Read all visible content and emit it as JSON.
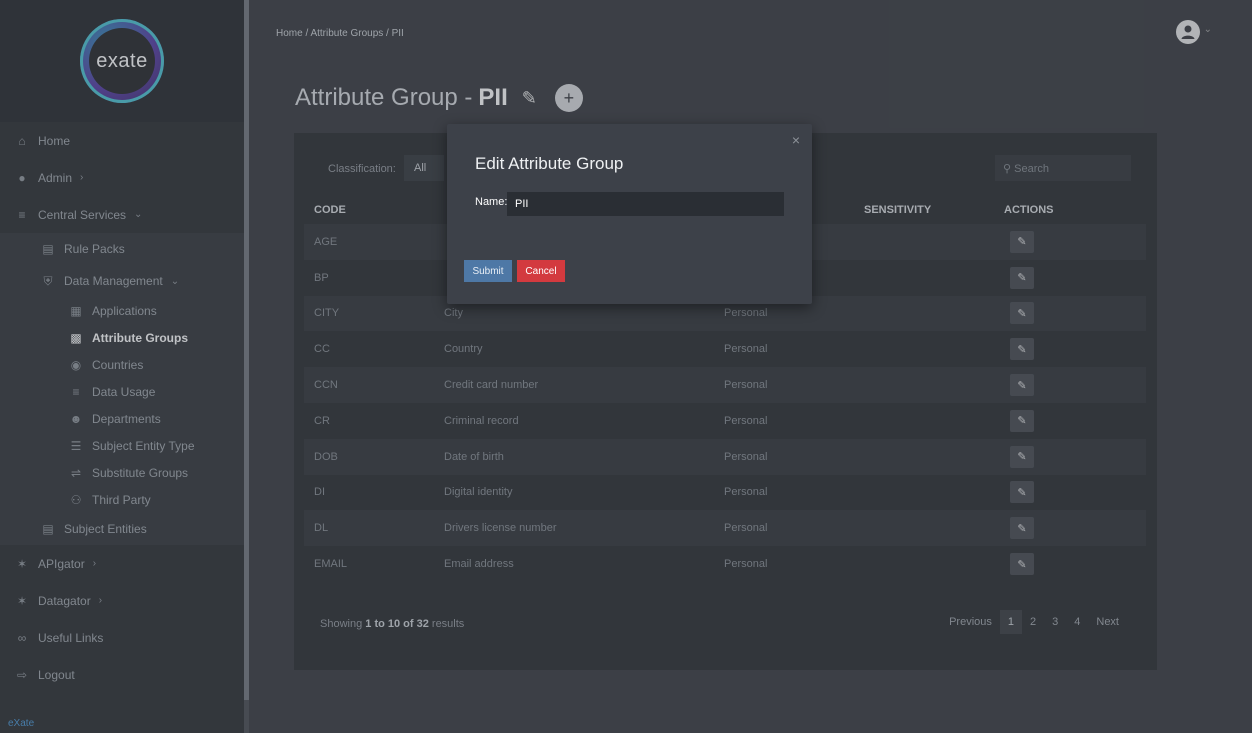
{
  "brand": {
    "logo_text": "exate",
    "footer": "eXate"
  },
  "sidebar": {
    "items": [
      {
        "label": "Home",
        "icon": "home-icon"
      },
      {
        "label": "Admin",
        "icon": "users-icon"
      },
      {
        "label": "Central Services",
        "icon": "database-icon"
      },
      {
        "label": "Rule Packs",
        "icon": "list-icon"
      },
      {
        "label": "Data Management",
        "icon": "shield-icon"
      },
      {
        "label": "Applications",
        "icon": "grid-icon"
      },
      {
        "label": "Attribute Groups",
        "icon": "id-card-icon"
      },
      {
        "label": "Countries",
        "icon": "globe-icon"
      },
      {
        "label": "Data Usage",
        "icon": "bars-icon"
      },
      {
        "label": "Departments",
        "icon": "user-icon"
      },
      {
        "label": "Subject Entity Type",
        "icon": "list-ul-icon"
      },
      {
        "label": "Substitute Groups",
        "icon": "swap-icon"
      },
      {
        "label": "Third Party",
        "icon": "group-icon"
      },
      {
        "label": "Subject Entities",
        "icon": "table-icon"
      },
      {
        "label": "APIgator",
        "icon": "apigator-icon"
      },
      {
        "label": "Datagator",
        "icon": "datagator-icon"
      },
      {
        "label": "Useful Links",
        "icon": "link-icon"
      },
      {
        "label": "Logout",
        "icon": "logout-icon"
      }
    ]
  },
  "breadcrumb": "Home /  Attribute Groups /  PII",
  "page": {
    "title_prefix": "Attribute Group - ",
    "title_name": "PII"
  },
  "filter": {
    "label": "Classification:",
    "value": "All"
  },
  "search": {
    "placeholder": "Search"
  },
  "table": {
    "headers": {
      "code": "CODE",
      "sensitivity": "SENSITIVITY",
      "actions": "ACTIONS"
    },
    "rows": [
      {
        "code": "AGE",
        "name": "",
        "classification": ""
      },
      {
        "code": "BP",
        "name": "",
        "classification": ""
      },
      {
        "code": "CITY",
        "name": "City",
        "classification": "Personal"
      },
      {
        "code": "CC",
        "name": "Country",
        "classification": "Personal"
      },
      {
        "code": "CCN",
        "name": "Credit card number",
        "classification": "Personal"
      },
      {
        "code": "CR",
        "name": "Criminal record",
        "classification": "Personal"
      },
      {
        "code": "DOB",
        "name": "Date of birth",
        "classification": "Personal"
      },
      {
        "code": "DI",
        "name": "Digital identity",
        "classification": "Personal"
      },
      {
        "code": "DL",
        "name": "Drivers license number",
        "classification": "Personal"
      },
      {
        "code": "EMAIL",
        "name": "Email address",
        "classification": "Personal"
      }
    ]
  },
  "footer": {
    "showing_prefix": "Showing ",
    "range": "1 to 10 of 32",
    "showing_suffix": " results"
  },
  "pager": {
    "previous": "Previous",
    "pages": [
      "1",
      "2",
      "3",
      "4"
    ],
    "next": "Next"
  },
  "modal": {
    "title": "Edit Attribute Group",
    "close": "×",
    "name_label": "Name:",
    "name_value": "PII",
    "submit": "Submit",
    "cancel": "Cancel"
  },
  "colors": {
    "submit": "#4e78a6",
    "cancel": "#d33a3f",
    "link": "#3d8fd1"
  }
}
